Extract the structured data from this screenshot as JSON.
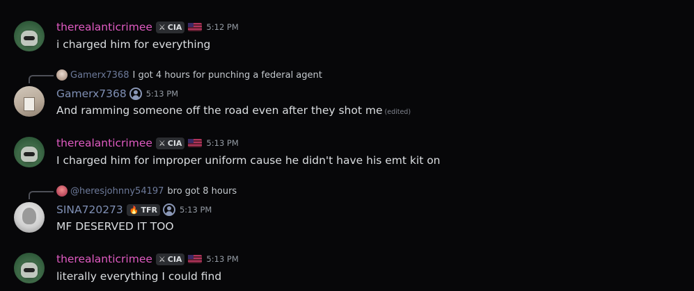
{
  "messages": [
    {
      "username": "therealanticrimee",
      "tag": "CIA",
      "tag_icon": "sword-icon",
      "time": "5:12 PM",
      "content": "i charged him for everything"
    },
    {
      "reply": {
        "name": "Gamerx7368",
        "text": "I got 4 hours for punching a federal agent"
      },
      "username": "Gamerx7368",
      "time": "5:13 PM",
      "content": "And ramming someone off the road even after they shot me",
      "edited": "(edited)"
    },
    {
      "username": "therealanticrimee",
      "tag": "CIA",
      "tag_icon": "sword-icon",
      "time": "5:13 PM",
      "content": "I charged him for improper uniform cause he didn't have his emt kit on"
    },
    {
      "reply": {
        "name": "@heresjohnny54197",
        "text": "bro got 8 hours"
      },
      "username": "SINA720273",
      "tag": "TFR",
      "tag_icon": "flame-icon",
      "time": "5:13 PM",
      "content": "MF DESERVED IT TOO"
    },
    {
      "username": "therealanticrimee",
      "tag": "CIA",
      "tag_icon": "sword-icon",
      "time": "5:13 PM",
      "content": "literally everything I could find"
    }
  ],
  "colors": {
    "background": "#070709",
    "username_pink": "#e05bc2",
    "username_blue": "#7f8fb4",
    "timestamp": "#949ba4"
  }
}
